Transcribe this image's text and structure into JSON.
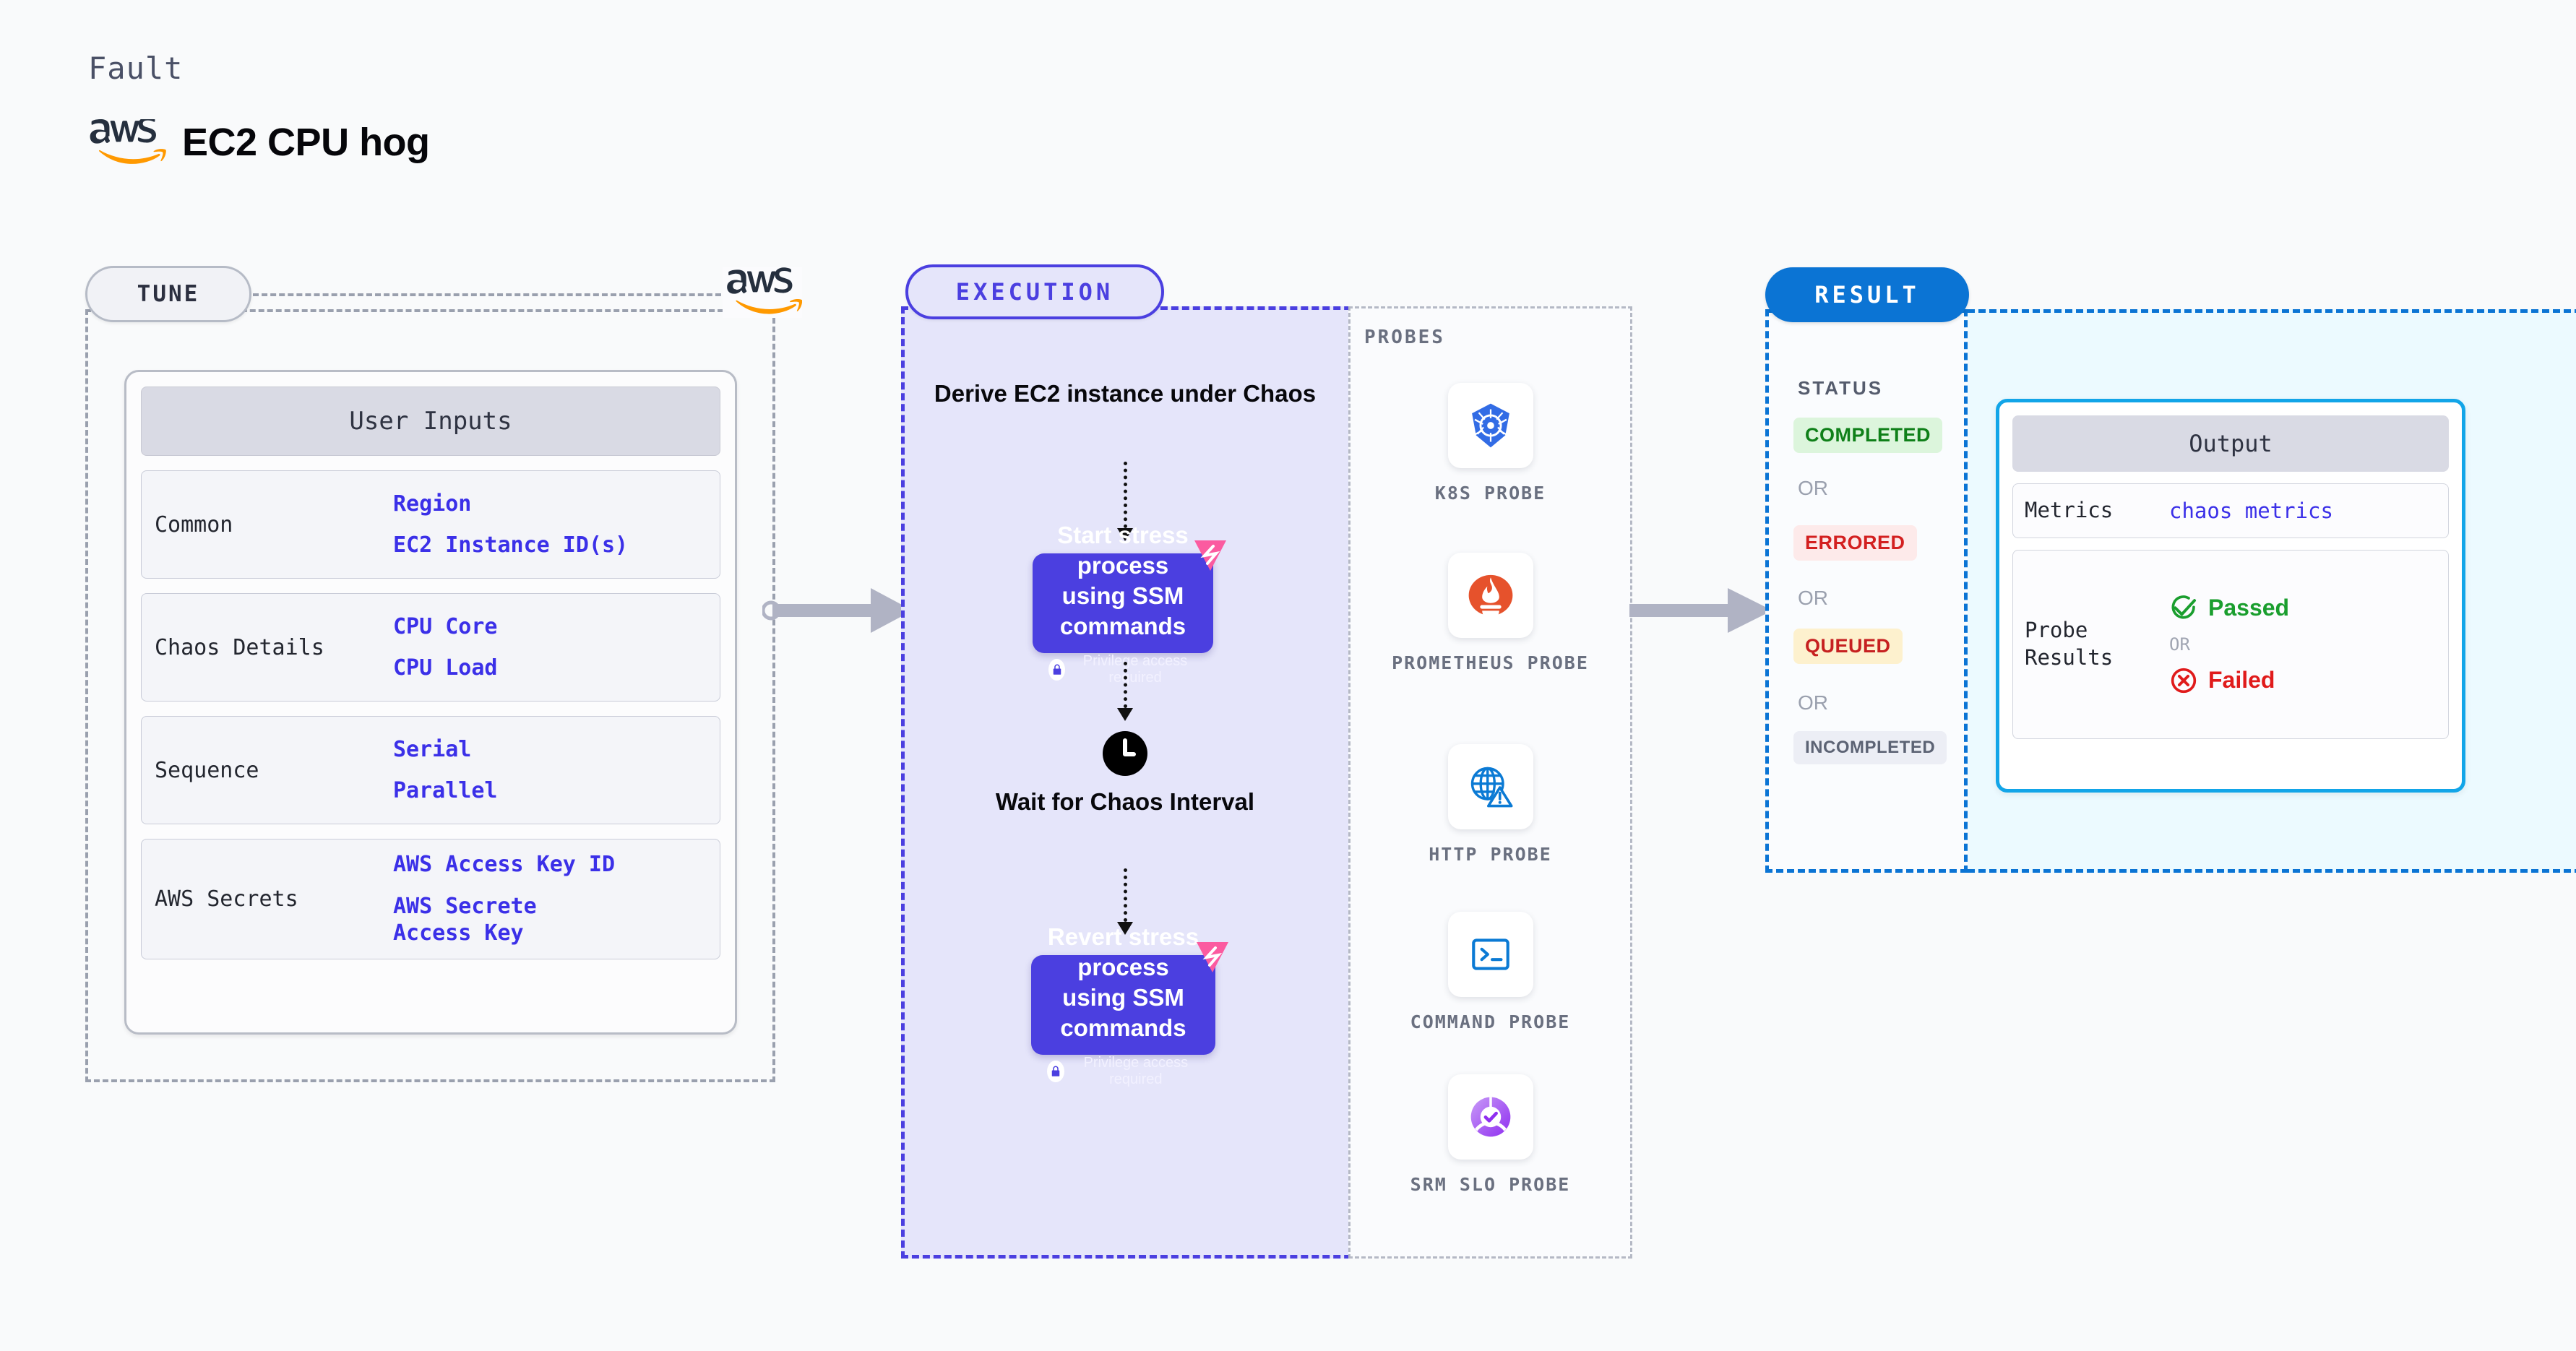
{
  "header": {
    "eyebrow": "Fault",
    "title": "EC2 CPU hog",
    "logo_icon": "aws-logo"
  },
  "colors": {
    "accent_purple": "#4b3fe0",
    "accent_blue": "#0b74d4",
    "accent_cyan": "#12a5e8",
    "value_blue": "#3b30e8",
    "aws_orange": "#ff9900",
    "harness_pink": "#fb5ba0",
    "success_green": "#1a9e2e",
    "error_red": "#d32020",
    "warn_yellow": "#fdf1ce",
    "panel_lavender": "#e5e5fa",
    "panel_ice": "#ecfaff"
  },
  "tune": {
    "pill_label": "TUNE",
    "brand_icon": "aws-logo",
    "card": {
      "title": "User Inputs",
      "rows": [
        {
          "label": "Common",
          "values": [
            "Region",
            "EC2 Instance ID(s)"
          ]
        },
        {
          "label": "Chaos Details",
          "values": [
            "CPU Core",
            "CPU Load"
          ]
        },
        {
          "label": "Sequence",
          "values": [
            "Serial",
            "Parallel"
          ]
        },
        {
          "label": "AWS Secrets",
          "values": [
            "AWS Access Key ID",
            "AWS Secrete\nAccess Key"
          ]
        }
      ]
    }
  },
  "execution": {
    "pill_label": "EXECUTION",
    "step1_text": "Derive EC2 instance\nunder Chaos",
    "block1": {
      "title": "Start stress process\nusing SSM\ncommands",
      "privilege_note": "Privilege access required",
      "lock_icon": "lock-icon",
      "corner_icon": "harness-logo-icon"
    },
    "wait": {
      "icon": "clock-icon",
      "text": "Wait for Chaos\nInterval"
    },
    "block2": {
      "title": "Revert stress\nprocess using SSM\ncommands",
      "privilege_note": "Privilege access required",
      "lock_icon": "lock-icon",
      "corner_icon": "harness-logo-icon"
    }
  },
  "probes": {
    "section_label": "PROBES",
    "items": [
      {
        "label": "K8S PROBE",
        "icon": "kubernetes-icon"
      },
      {
        "label": "PROMETHEUS\nPROBE",
        "icon": "prometheus-icon"
      },
      {
        "label": "HTTP PROBE",
        "icon": "http-globe-warning-icon"
      },
      {
        "label": "COMMAND\nPROBE",
        "icon": "terminal-icon"
      },
      {
        "label": "SRM SLO\nPROBE",
        "icon": "srm-slo-icon"
      }
    ]
  },
  "result": {
    "pill_label": "RESULT",
    "status_label": "STATUS",
    "or_label": "OR",
    "statuses": [
      {
        "label": "COMPLETED",
        "bg": "#dcf5dc",
        "fg": "#0f8019"
      },
      {
        "label": "ERRORED",
        "bg": "#fdeaea",
        "fg": "#d32020"
      },
      {
        "label": "QUEUED",
        "bg": "#fdf1ce",
        "fg": "#c62020"
      },
      {
        "label": "INCOMPLETED",
        "bg": "#eceef5",
        "fg": "#5c6374"
      }
    ],
    "output": {
      "title": "Output",
      "metrics_label": "Metrics",
      "metrics_value": "chaos metrics",
      "probe_results_label": "Probe\nResults",
      "passed_label": "Passed",
      "passed_icon": "check-circle-icon",
      "or_label": "OR",
      "failed_label": "Failed",
      "failed_icon": "x-circle-icon"
    }
  }
}
